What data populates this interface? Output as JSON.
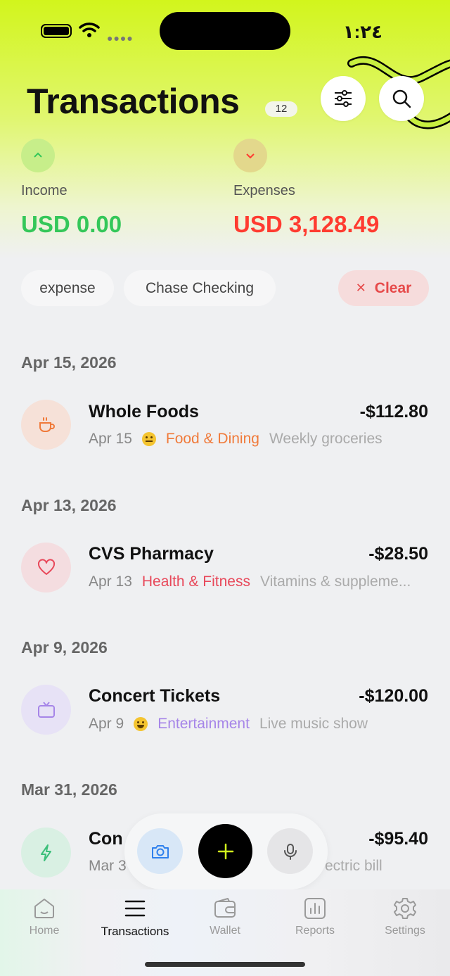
{
  "status_bar": {
    "time": "١:٢٤"
  },
  "header": {
    "title": "Transactions",
    "count": "12",
    "income_label": "Income",
    "income_value": "USD 0.00",
    "expenses_label": "Expenses",
    "expenses_value": "USD 3,128.49",
    "filter_icon": "sliders-icon",
    "search_icon": "search-icon"
  },
  "filters": {
    "chips": [
      "expense",
      "Chase Checking"
    ],
    "clear_label": "Clear"
  },
  "groups": [
    {
      "date": "Apr 15, 2026",
      "tx": {
        "name": "Whole Foods",
        "amount": "-$112.80",
        "date": "Apr 15",
        "mood": "neutral",
        "category": "Food & Dining",
        "note": "Weekly groceries",
        "icon": "coffee-cup-icon",
        "color": "#f07a3a"
      }
    },
    {
      "date": "Apr 13, 2026",
      "tx": {
        "name": "CVS Pharmacy",
        "amount": "-$28.50",
        "date": "Apr 13",
        "mood": "",
        "category": "Health & Fitness",
        "note": "Vitamins & suppleme...",
        "icon": "heart-icon",
        "color": "#e8485a"
      }
    },
    {
      "date": "Apr 9, 2026",
      "tx": {
        "name": "Concert Tickets",
        "amount": "-$120.00",
        "date": "Apr 9",
        "mood": "laugh",
        "category": "Entertainment",
        "note": "Live music show",
        "icon": "tv-icon",
        "color": "#a685e8"
      }
    },
    {
      "date": "Mar 31, 2026",
      "tx": {
        "name": "Con",
        "amount": "-$95.40",
        "date": "Mar 3",
        "mood": "",
        "category": "",
        "note": "ectric bill",
        "icon": "lightning-icon",
        "color": "#3cbf7a"
      }
    }
  ],
  "fab": {
    "camera_icon": "camera-icon",
    "add_icon": "plus-icon",
    "mic_icon": "microphone-icon"
  },
  "tabs": [
    {
      "label": "Home",
      "icon": "home-icon",
      "active": false
    },
    {
      "label": "Transactions",
      "icon": "list-icon",
      "active": true
    },
    {
      "label": "Wallet",
      "icon": "wallet-icon",
      "active": false
    },
    {
      "label": "Reports",
      "icon": "bar-chart-icon",
      "active": false
    },
    {
      "label": "Settings",
      "icon": "gear-icon",
      "active": false
    }
  ],
  "colors": {
    "accent": "#d2f51c",
    "income": "#34c759",
    "expense": "#ff3b30"
  }
}
